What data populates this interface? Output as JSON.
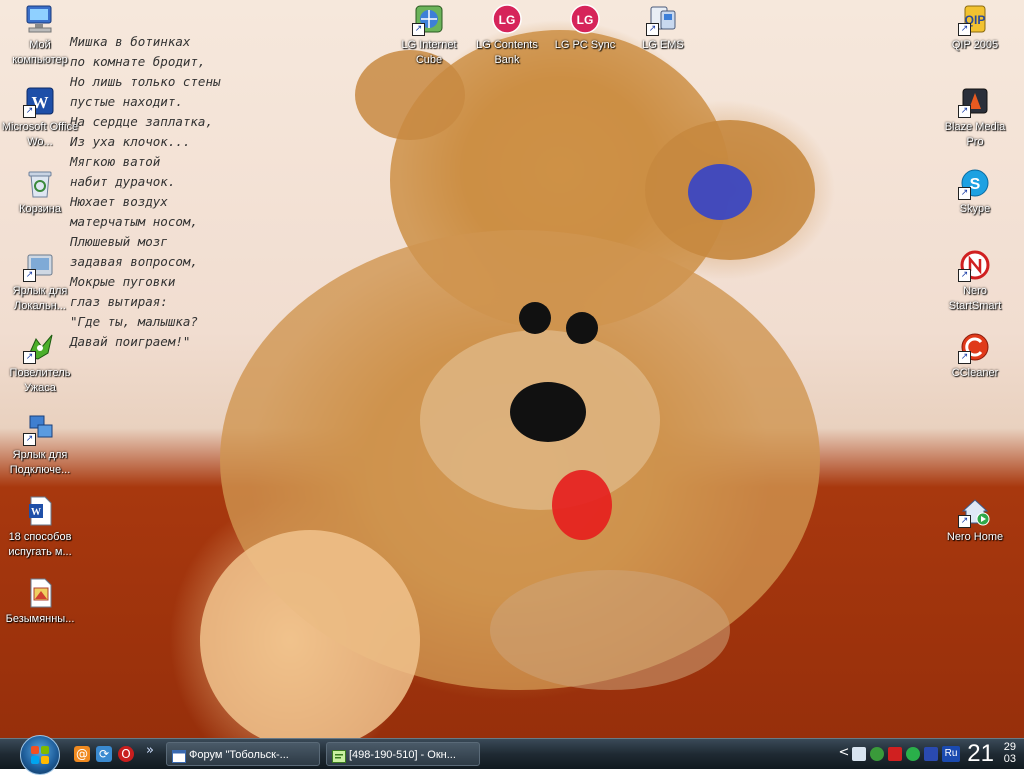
{
  "poem": {
    "lines": [
      "Мишка в ботинках",
      "по комнате бродит,",
      "Но лишь только стены",
      "пустые находит.",
      "На сердце заплатка,",
      "Из уха клочок...",
      "Мягкою ватой",
      "набит дурачок.",
      "Нюхает воздух",
      "матерчатым носом,",
      "Плюшевый мозг",
      "задавая вопросом,",
      "Мокрые пуговки",
      "глаз вытирая:",
      "\"Где ты, малышка?",
      "Давай поиграем!\""
    ]
  },
  "desktop_icons": [
    {
      "label": "Мой компьютер",
      "icon": "my-computer-icon"
    },
    {
      "label": "Microsoft Office Wo...",
      "icon": "word-shortcut-icon"
    },
    {
      "label": "Корзина",
      "icon": "recycle-bin-icon"
    },
    {
      "label": "Ярлык для Локальн...",
      "icon": "shortcut-icon"
    },
    {
      "label": "Повелитель Ужаса",
      "icon": "game-icon"
    },
    {
      "label": "Ярлык для Подключе...",
      "icon": "network-shortcut-icon"
    },
    {
      "label": "18 способов испугать м...",
      "icon": "word-document-icon"
    },
    {
      "label": "Безымянны...",
      "icon": "paint-image-icon"
    },
    {
      "label": "LG Internet Cube",
      "icon": "lg-internet-cube-icon"
    },
    {
      "label": "LG Contents Bank",
      "icon": "lg-contents-bank-icon"
    },
    {
      "label": "LG PC Sync",
      "icon": "lg-pc-sync-icon"
    },
    {
      "label": "LG EMS",
      "icon": "lg-ems-icon"
    },
    {
      "label": "QIP 2005",
      "icon": "qip-icon"
    },
    {
      "label": "Blaze Media Pro",
      "icon": "blaze-media-icon"
    },
    {
      "label": "Skype",
      "icon": "skype-icon"
    },
    {
      "label": "Nero StartSmart",
      "icon": "nero-startsmart-icon"
    },
    {
      "label": "CCleaner",
      "icon": "ccleaner-icon"
    },
    {
      "label": "Nero Home",
      "icon": "nero-home-icon"
    }
  ],
  "taskbar": {
    "start": "start-button",
    "quick_launch": [
      "mail-icon",
      "network-icon",
      "opera-icon"
    ],
    "overflow": "»",
    "tasks": [
      {
        "label": "Форум \"Тобольск-...",
        "icon": "browser-icon"
      },
      {
        "label": "[498-190-510] - Окн...",
        "icon": "chat-window-icon"
      }
    ],
    "tray_expand": "<",
    "language": "Ru",
    "clock": {
      "time": "21",
      "day": "29",
      "month": "03"
    }
  },
  "colors": {
    "wall": "#f1ddd0",
    "floor": "#a8380e",
    "bear": "#c98a40",
    "taskbar": "#1f2a33"
  }
}
